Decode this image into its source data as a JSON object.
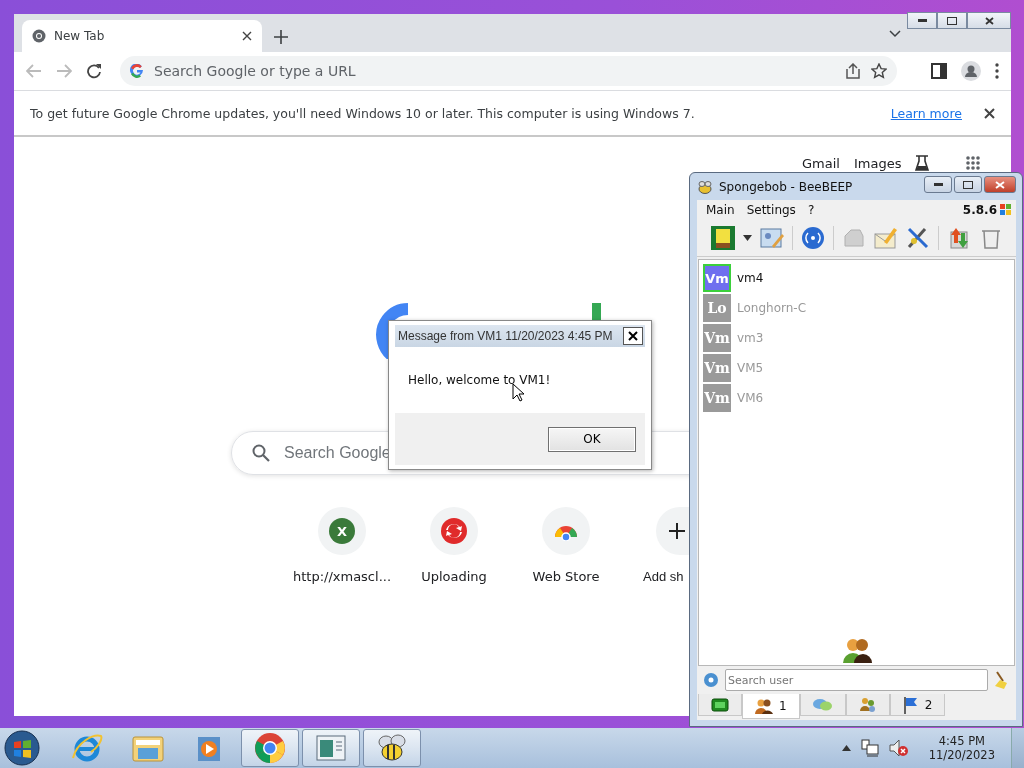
{
  "chrome": {
    "tab": {
      "title": "New Tab",
      "selected": true
    },
    "address": {
      "placeholder": "Search Google or type a URL"
    },
    "infobar": {
      "message": "To get future Google Chrome updates, you'll need Windows 10 or later. This computer is using Windows 7.",
      "link": "Learn more"
    },
    "header_links": [
      "Gmail",
      "Images"
    ],
    "search": {
      "placeholder": "Search Google"
    },
    "shortcuts": [
      {
        "label": "http://xmascl...",
        "kind": "letter",
        "icon_text": "X"
      },
      {
        "label": "Uploading",
        "kind": "sync"
      },
      {
        "label": "Web Store",
        "kind": "store"
      },
      {
        "label": "Add sh",
        "kind": "add"
      }
    ]
  },
  "dialog": {
    "title": "Message from VM1 11/20/2023 4:45 PM",
    "message": "Hello, welcome to VM1!",
    "button": "OK"
  },
  "beebeep": {
    "title": "Spongebob - BeeBEEP",
    "menu": [
      "Main",
      "Settings",
      "?"
    ],
    "version": "5.8.6",
    "users": [
      {
        "initials": "Vm",
        "name": "vm4",
        "online": true
      },
      {
        "initials": "Lo",
        "name": "Longhorn-C",
        "online": false
      },
      {
        "initials": "Vm",
        "name": "vm3",
        "online": false
      },
      {
        "initials": "Vm",
        "name": "VM5",
        "online": false
      },
      {
        "initials": "Vm",
        "name": "VM6",
        "online": false
      }
    ],
    "search": {
      "placeholder": "Search user"
    },
    "tabs": [
      {
        "kind": "computer",
        "selected": false
      },
      {
        "kind": "users",
        "count": "1",
        "selected": true
      },
      {
        "kind": "chat",
        "selected": false
      },
      {
        "kind": "groups",
        "selected": false
      },
      {
        "kind": "flag",
        "count": "2",
        "selected": false
      }
    ]
  },
  "taskbar": {
    "apps": [
      {
        "kind": "ie",
        "running": false
      },
      {
        "kind": "explorer",
        "running": false
      },
      {
        "kind": "media",
        "running": false
      },
      {
        "kind": "chrome",
        "running": true
      },
      {
        "kind": "notes",
        "running": true
      },
      {
        "kind": "bee",
        "running": true
      }
    ],
    "time": "4:45 PM",
    "date": "11/20/2023"
  }
}
